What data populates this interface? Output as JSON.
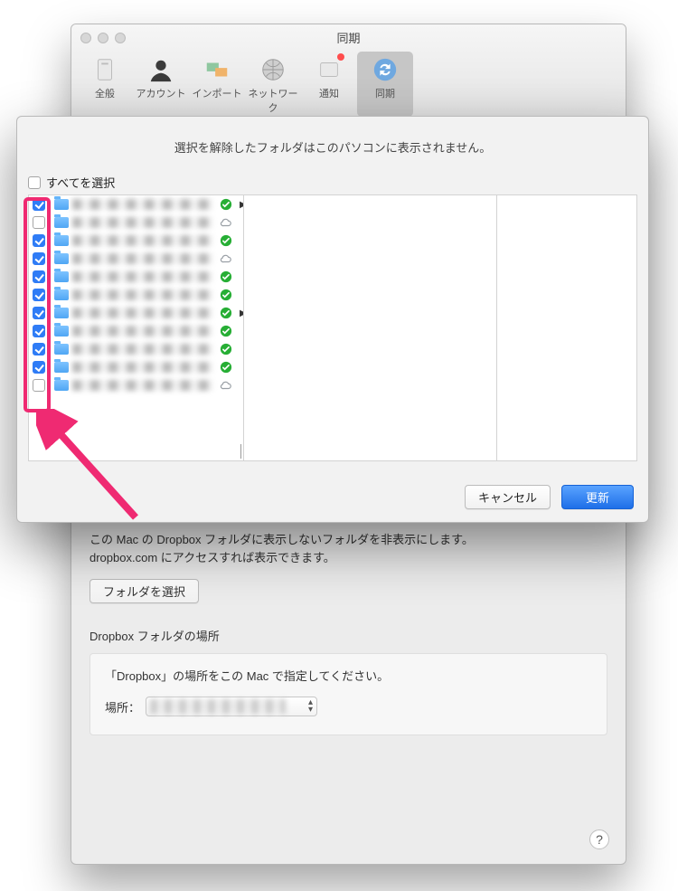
{
  "window": {
    "title": "同期"
  },
  "toolbar": {
    "items": [
      {
        "label": "全般"
      },
      {
        "label": "アカウント"
      },
      {
        "label": "インポート"
      },
      {
        "label": "ネットワーク"
      },
      {
        "label": "通知"
      },
      {
        "label": "同期"
      }
    ]
  },
  "body": {
    "desc1": "この Mac の Dropbox フォルダに表示しないフォルダを非表示にします。",
    "desc2": "dropbox.com にアクセスすれば表示できます。",
    "select_folders_label": "フォルダを選択",
    "location_title": "Dropbox フォルダの場所",
    "location_desc": "「Dropbox」の場所をこの Mac で指定してください。",
    "location_label": "場所："
  },
  "sheet": {
    "message": "選択を解除したフォルダはこのパソコンに表示されません。",
    "select_all_label": "すべてを選択",
    "cancel_label": "キャンセル",
    "update_label": "更新",
    "rows": [
      {
        "checked": true,
        "status": "green",
        "disclosure": true
      },
      {
        "checked": false,
        "status": "cloud",
        "disclosure": false
      },
      {
        "checked": true,
        "status": "green",
        "disclosure": false
      },
      {
        "checked": true,
        "status": "cloud",
        "disclosure": false
      },
      {
        "checked": true,
        "status": "green",
        "disclosure": false
      },
      {
        "checked": true,
        "status": "green",
        "disclosure": false
      },
      {
        "checked": true,
        "status": "green",
        "disclosure": true
      },
      {
        "checked": true,
        "status": "green",
        "disclosure": false
      },
      {
        "checked": true,
        "status": "green",
        "disclosure": false
      },
      {
        "checked": true,
        "status": "green",
        "disclosure": false
      },
      {
        "checked": false,
        "status": "cloud",
        "disclosure": false
      }
    ]
  },
  "help": "?"
}
